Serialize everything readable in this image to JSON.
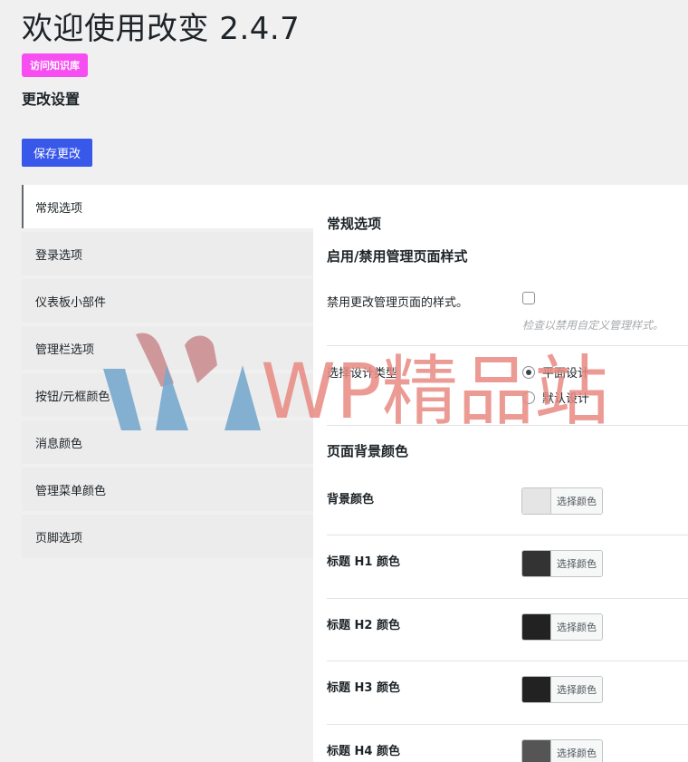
{
  "header": {
    "title": "欢迎使用改变 2.4.7",
    "kb_badge": "访问知识库",
    "settings_heading": "更改设置",
    "save_label": "保存更改"
  },
  "sidebar": {
    "items": [
      {
        "label": "常规选项",
        "active": true
      },
      {
        "label": "登录选项"
      },
      {
        "label": "仪表板小部件"
      },
      {
        "label": "管理栏选项"
      },
      {
        "label": "按钮/元框颜色"
      },
      {
        "label": "消息颜色"
      },
      {
        "label": "管理菜单颜色"
      },
      {
        "label": "页脚选项"
      }
    ]
  },
  "panel": {
    "section_title": "常规选项",
    "admin_style_heading": "启用/禁用管理页面样式",
    "disable_style_label": "禁用更改管理页面的样式。",
    "disable_style_hint": "检查以禁用自定义管理样式。",
    "design_type_label": "选择设计类型",
    "design_options": [
      "平面设计",
      "默认设计"
    ],
    "design_selected": "平面设计",
    "bg_heading": "页面背景颜色",
    "pick_label": "选择颜色",
    "colors": [
      {
        "label": "背景颜色",
        "color": "#e5e5e5"
      },
      {
        "label": "标题 H1 颜色",
        "color": "#333333"
      },
      {
        "label": "标题 H2 颜色",
        "color": "#222222"
      },
      {
        "label": "标题 H3 颜色",
        "color": "#222222"
      },
      {
        "label": "标题 H4 颜色",
        "color": "#555555"
      }
    ]
  },
  "watermark": {
    "text": "WP精品站"
  },
  "theme": {
    "accent": "#3858e9",
    "badge": "#f74ef2"
  }
}
